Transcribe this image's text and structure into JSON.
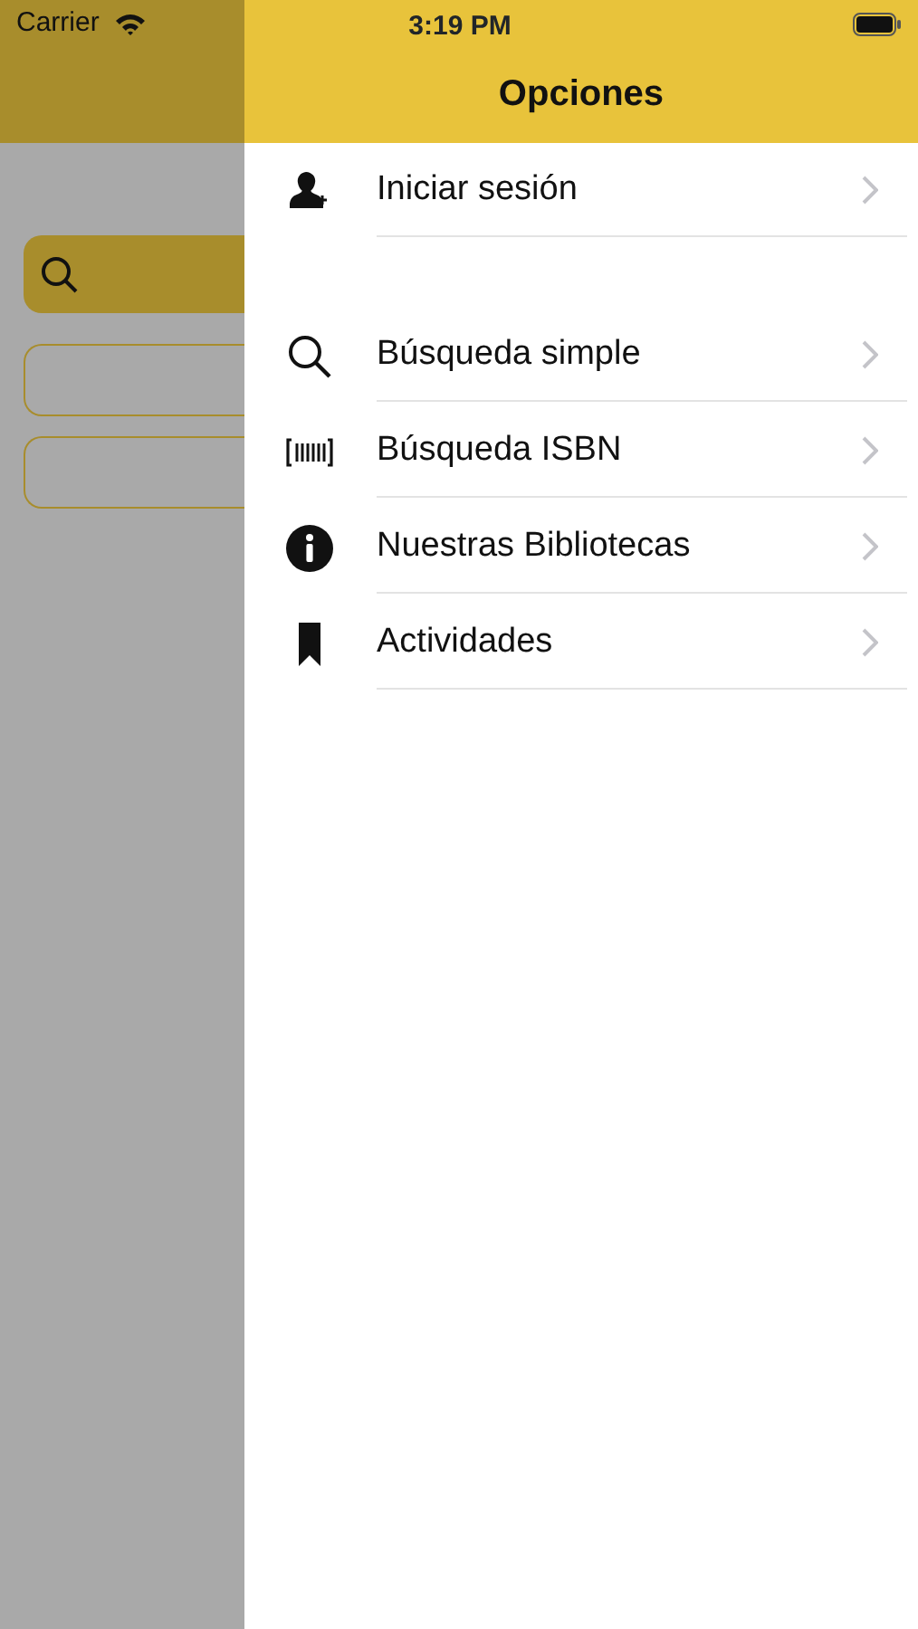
{
  "status_bar": {
    "carrier": "Carrier",
    "time": "3:19 PM"
  },
  "drawer": {
    "title": "Opciones",
    "sections": [
      {
        "items": [
          {
            "label": "Iniciar sesión"
          }
        ]
      },
      {
        "items": [
          {
            "label": "Búsqueda simple"
          },
          {
            "label": "Búsqueda ISBN"
          },
          {
            "label": "Nuestras Bibliotecas"
          },
          {
            "label": "Actividades"
          }
        ]
      }
    ]
  }
}
